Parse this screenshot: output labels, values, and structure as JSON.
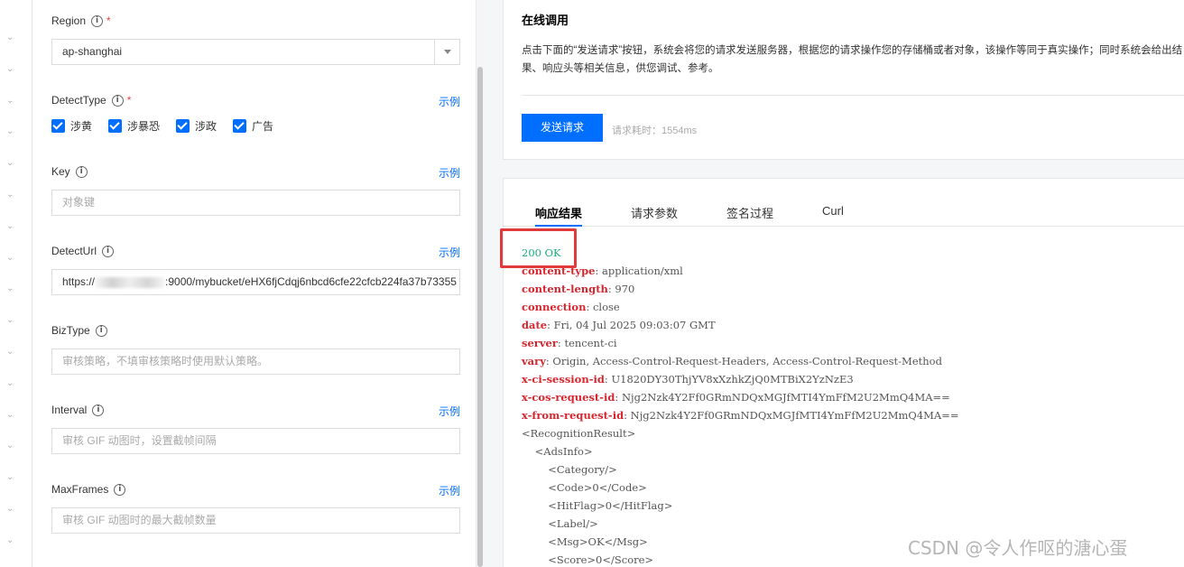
{
  "form": {
    "region": {
      "label": "Region",
      "required_mark": "*",
      "value": "ap-shanghai"
    },
    "detect_type": {
      "label": "DetectType",
      "required_mark": "*",
      "example": "示例",
      "options": [
        "涉黄",
        "涉暴恐",
        "涉政",
        "广告"
      ],
      "checked": [
        true,
        true,
        true,
        true
      ]
    },
    "key": {
      "label": "Key",
      "example": "示例",
      "placeholder": "对象键"
    },
    "detect_url": {
      "label": "DetectUrl",
      "example": "示例",
      "value_prefix": "https://",
      "value_suffix": ":9000/mybucket/eHX6fjCdqj6nbcd6cfe22cfcb224fa37b73355"
    },
    "biz_type": {
      "label": "BizType",
      "placeholder": "审核策略，不填审核策略时使用默认策略。"
    },
    "interval": {
      "label": "Interval",
      "example": "示例",
      "placeholder": "审核 GIF 动图时，设置截帧间隔"
    },
    "max_frames": {
      "label": "MaxFrames",
      "example": "示例",
      "placeholder": "审核 GIF 动图时的最大截帧数量"
    }
  },
  "online_call": {
    "title": "在线调用",
    "description": "点击下面的“发送请求”按钮，系统会将您的请求发送服务器，根据您的请求操作您的存储桶或者对象，该操作等同于真实操作；同时系统会给出结果、响应头等相关信息，供您调试、参考。",
    "send_button": "发送请求",
    "elapsed": "请求耗时：1554ms"
  },
  "tabs": [
    "响应结果",
    "请求参数",
    "签名过程",
    "Curl"
  ],
  "active_tab": 0,
  "response": {
    "status": "200 OK",
    "headers": [
      {
        "key": "content-type",
        "value": "application/xml"
      },
      {
        "key": "content-length",
        "value": "970"
      },
      {
        "key": "connection",
        "value": "close"
      },
      {
        "key": "date",
        "value": "Fri, 04 Jul 2025 09:03:07 GMT"
      },
      {
        "key": "server",
        "value": "tencent-ci"
      },
      {
        "key": "vary",
        "value": "Origin, Access-Control-Request-Headers, Access-Control-Request-Method"
      },
      {
        "key": "x-ci-session-id",
        "value": "U1820DY30ThjYV8xXzhkZjQ0MTBiX2YzNzE3"
      },
      {
        "key": "x-cos-request-id",
        "value": "Njg2Nzk4Y2Ff0GRmNDQxMGJfMTI4YmFfM2U2MmQ4MA=="
      },
      {
        "key": "x-from-request-id",
        "value": "Njg2Nzk4Y2Ff0GRmNDQxMGJfMTI4YmFfM2U2MmQ4MA=="
      }
    ],
    "xml_lines": [
      "<RecognitionResult>",
      "    <AdsInfo>",
      "        <Category/>",
      "        <Code>0</Code>",
      "        <HitFlag>0</HitFlag>",
      "        <Label/>",
      "        <Msg>OK</Msg>",
      "        <Score>0</Score>"
    ]
  },
  "watermark": "CSDN @令人作呕的溏心蛋",
  "colors": {
    "accent": "#006eff",
    "status_ok": "#1aae7a",
    "header_key": "#d8262e",
    "highlight_box": "#e03a3a"
  }
}
